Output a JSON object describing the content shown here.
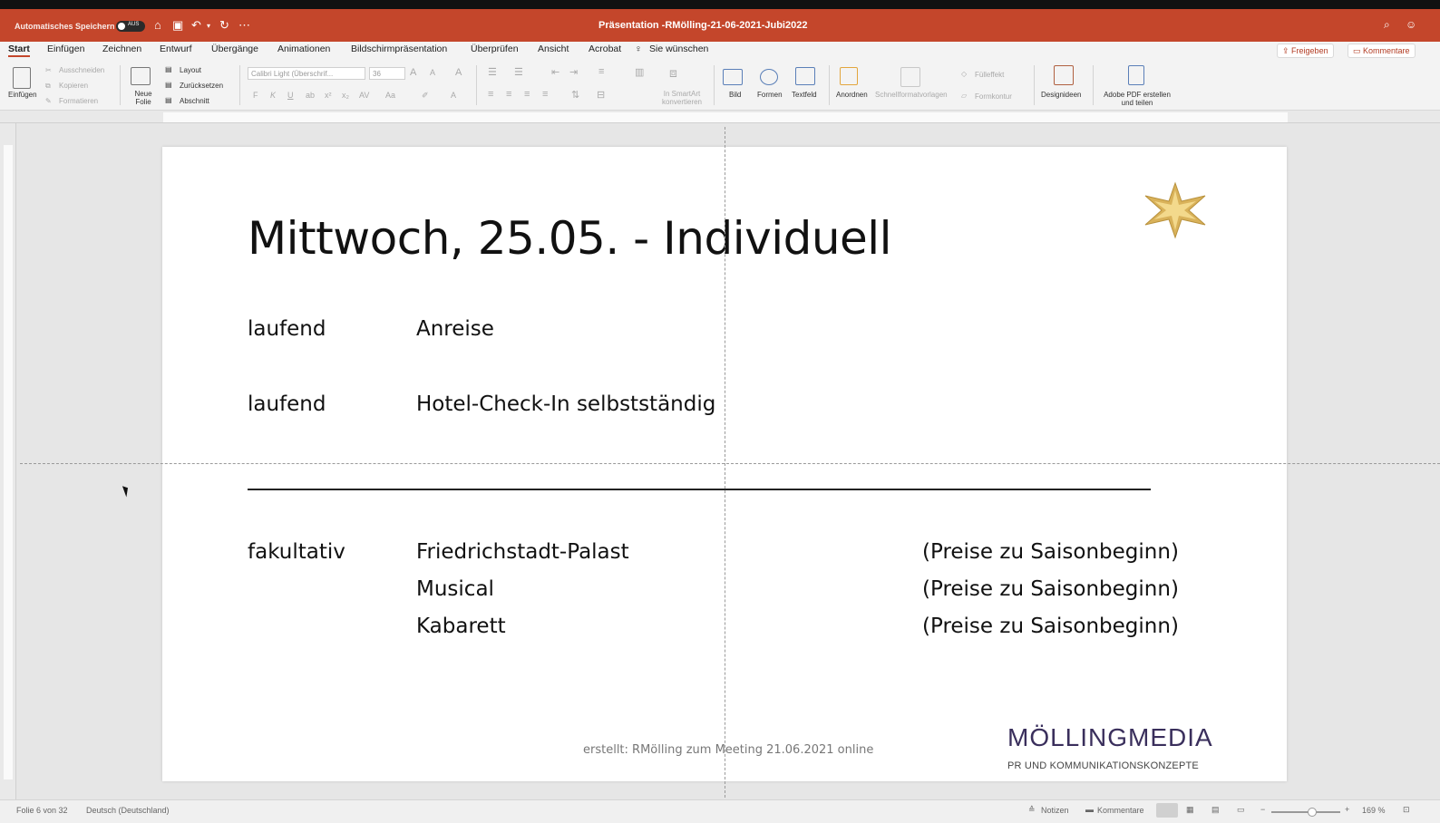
{
  "titlebar": {
    "autosave_label": "Automatisches Speichern",
    "autosave_state": "AUS",
    "document_title": "Präsentation -RMölling-21-06-2021-Jubi2022"
  },
  "tabs": [
    "Start",
    "Einfügen",
    "Zeichnen",
    "Entwurf",
    "Übergänge",
    "Animationen",
    "Bildschirmpräsentation",
    "Überprüfen",
    "Ansicht",
    "Acrobat"
  ],
  "tell_me": "Sie wünschen",
  "share": "Freigeben",
  "comments": "Kommentare",
  "ribbon": {
    "paste": "Einfügen",
    "cut": "Ausschneiden",
    "copy": "Kopieren",
    "format": "Formatieren",
    "new_slide": "Neue Folie",
    "layout": "Layout",
    "reset": "Zurücksetzen",
    "section": "Abschnitt",
    "font_name": "Calibri Light (Überschrif...",
    "font_size": "36",
    "smartart": "In SmartArt konvertieren",
    "picture": "Bild",
    "shapes": "Formen",
    "textbox": "Textfeld",
    "arrange": "Anordnen",
    "quick_styles": "Schnellformatvorlagen",
    "fill_effect": "Fülleffekt",
    "outline": "Formkontur",
    "designer": "Designideen",
    "adobe_pdf": "Adobe PDF erstellen und teilen"
  },
  "slide": {
    "title": "Mittwoch, 25.05. - Individuell",
    "rows_top": [
      {
        "label": "laufend",
        "text": "Anreise"
      },
      {
        "label": "laufend",
        "text": "Hotel-Check-In selbstständig"
      }
    ],
    "optional_label": "fakultativ",
    "rows_bottom": [
      {
        "text": "Friedrichstadt-Palast",
        "price": "(Preise zu Saisonbeginn)"
      },
      {
        "text": "Musical",
        "price": "(Preise zu Saisonbeginn)"
      },
      {
        "text": "Kabarett",
        "price": "(Preise zu Saisonbeginn)"
      }
    ],
    "footer": "erstellt: RMölling zum Meeting 21.06.2021 online",
    "logo_main": "MÖLLINGMEDIA",
    "logo_sub": "PR UND KOMMUNIKATIONSKONZEPTE"
  },
  "status": {
    "slide_info": "Folie 6 von 32",
    "language": "Deutsch (Deutschland)",
    "notes": "Notizen",
    "comments": "Kommentare",
    "zoom": "169 %"
  },
  "colors": {
    "accent": "#c4462b",
    "logo": "#3a2f5c",
    "star": "#d9b25a"
  }
}
